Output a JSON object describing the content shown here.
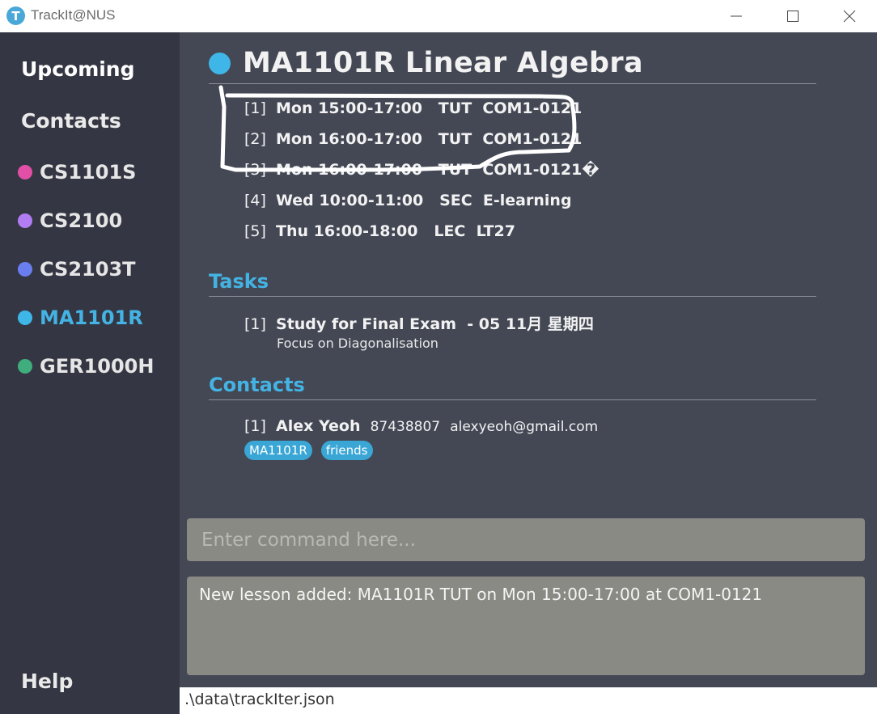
{
  "window": {
    "app_icon_letter": "T",
    "title": "TrackIt@NUS"
  },
  "sidebar": {
    "upcoming_label": "Upcoming",
    "contacts_label": "Contacts",
    "help_label": "Help",
    "modules": [
      {
        "code": "CS1101S",
        "color": "#e14fa6"
      },
      {
        "code": "CS2100",
        "color": "#b27cf2"
      },
      {
        "code": "CS2103T",
        "color": "#6b7ef0"
      },
      {
        "code": "MA1101R",
        "color": "#3fb6e8",
        "active": true
      },
      {
        "code": "GER1000H",
        "color": "#3fae7c"
      }
    ]
  },
  "module": {
    "title": "MA1101R Linear Algebra",
    "color": "#3fb6e8",
    "lessons": [
      {
        "index": "[1]",
        "text": "Mon 15:00-17:00   TUT  COM1-0121"
      },
      {
        "index": "[2]",
        "text": "Mon 16:00-17:00   TUT  COM1-0121"
      },
      {
        "index": "[3]",
        "text": "Mon 16:00-17:00   TUT  COM1-0121�"
      },
      {
        "index": "[4]",
        "text": "Wed 10:00-11:00   SEC  E-learning"
      },
      {
        "index": "[5]",
        "text": "Thu 16:00-18:00   LEC  LT27"
      }
    ]
  },
  "tasks": {
    "title": "Tasks",
    "items": [
      {
        "index": "[1]",
        "name": "Study for Final Exam",
        "deadline": "  - 05 11月 星期四",
        "description": "Focus on Diagonalisation"
      }
    ]
  },
  "contacts": {
    "title": "Contacts",
    "items": [
      {
        "index": "[1]",
        "name": "Alex Yeoh",
        "phone": "87438807",
        "email": "alexyeoh@gmail.com",
        "tags": [
          "MA1101R",
          "friends"
        ]
      }
    ]
  },
  "command": {
    "placeholder": "Enter command here...",
    "value": ""
  },
  "result": {
    "text": "New lesson added: MA1101R TUT on Mon 15:00-17:00 at COM1-0121"
  },
  "status": {
    "path": ".\\data\\trackIter.json"
  }
}
